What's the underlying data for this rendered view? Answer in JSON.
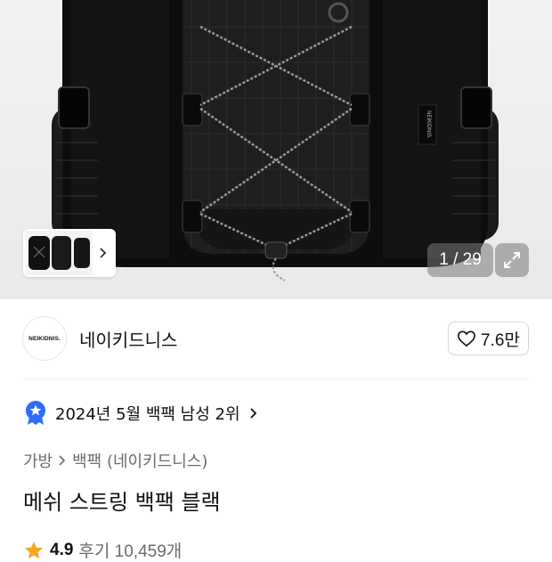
{
  "hero": {
    "counter": "1 / 29",
    "brand_tag": "NEIKIDNIS."
  },
  "brand": {
    "logo_text": "NEIKIDNIS.",
    "name": "네이키드니스",
    "like_count": "7.6만"
  },
  "ranking": {
    "text": "2024년 5월 백팩 남성 2위"
  },
  "breadcrumb": {
    "items": [
      "가방",
      "백팩 (네이키드니스)"
    ]
  },
  "product": {
    "title": "메쉬 스트링 백팩 블랙"
  },
  "rating": {
    "score": "4.9",
    "reviews": "후기 10,459개"
  },
  "colors": {
    "star": "#f5a623",
    "badge_blue": "#2f6bff",
    "text": "#111111",
    "muted": "#6b6b6b"
  }
}
